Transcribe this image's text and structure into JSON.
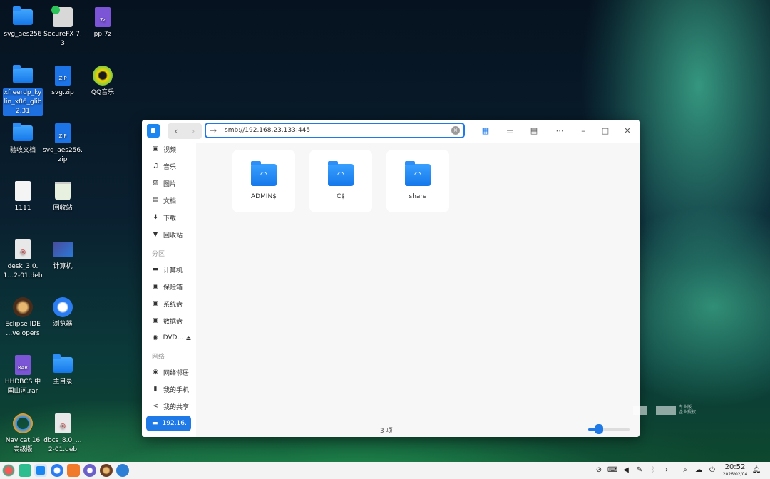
{
  "desktop": {
    "icons": [
      {
        "label": "svg_aes256",
        "icon": "folder-icon"
      },
      {
        "label": "SecureFX 7.3",
        "icon": "securefx-icon"
      },
      {
        "label": "pp.7z",
        "icon": "archive-7z-icon"
      },
      {
        "label": "xfreerdp_kylin_x86_glib2.31",
        "icon": "folder-icon"
      },
      {
        "label": "svg.zip",
        "icon": "zip-icon"
      },
      {
        "label": "QQ音乐",
        "icon": "qqmusic-icon"
      },
      {
        "label": "验收文档",
        "icon": "folder-icon"
      },
      {
        "label": "svg_aes256.zip",
        "icon": "zip-icon"
      },
      {
        "label": "1111",
        "icon": "text-file-icon"
      },
      {
        "label": "回收站",
        "icon": "trash-icon"
      },
      {
        "label": "desk_3.0.1…2-01.deb",
        "icon": "deb-package-icon"
      },
      {
        "label": "计算机",
        "icon": "computer-icon"
      },
      {
        "label": "Eclipse IDE …velopers",
        "icon": "eclipse-icon"
      },
      {
        "label": "浏览器",
        "icon": "browser-icon"
      },
      {
        "label": "HHDBCS 中国山河.rar",
        "icon": "rar-icon"
      },
      {
        "label": "主目录",
        "icon": "home-folder-icon"
      },
      {
        "label": "Navicat 16 高级版",
        "icon": "navicat-icon"
      },
      {
        "label": "dbcs_8.0_…2-01.deb",
        "icon": "deb-package-icon"
      }
    ]
  },
  "window": {
    "address": "smb://192.168.23.133:445",
    "sidebar": {
      "items_top": [
        {
          "label": "视频",
          "icon": "video-icon",
          "glyph": "▣"
        },
        {
          "label": "音乐",
          "icon": "music-icon",
          "glyph": "♫"
        },
        {
          "label": "图片",
          "icon": "picture-icon",
          "glyph": "▨"
        },
        {
          "label": "文档",
          "icon": "document-icon",
          "glyph": "▤"
        },
        {
          "label": "下载",
          "icon": "download-icon",
          "glyph": "⬇"
        },
        {
          "label": "回收站",
          "icon": "trash-icon",
          "glyph": "▼"
        }
      ],
      "group_partition": "分区",
      "items_partition": [
        {
          "label": "计算机",
          "icon": "computer-icon",
          "glyph": "▬"
        },
        {
          "label": "保险箱",
          "icon": "safe-icon",
          "glyph": "▣"
        },
        {
          "label": "系统盘",
          "icon": "disk-icon",
          "glyph": "▣"
        },
        {
          "label": "数据盘",
          "icon": "disk-icon",
          "glyph": "▣"
        },
        {
          "label": "DVD…",
          "icon": "dvd-icon",
          "glyph": "◉"
        }
      ],
      "group_network": "网络",
      "items_network": [
        {
          "label": "网络邻居",
          "icon": "network-icon",
          "glyph": "◉"
        },
        {
          "label": "我的手机",
          "icon": "phone-icon",
          "glyph": "▮"
        },
        {
          "label": "我的共享",
          "icon": "share-icon",
          "glyph": "<"
        },
        {
          "label": "192.16…",
          "icon": "smb-folder-icon",
          "glyph": "▬"
        }
      ]
    },
    "files": [
      {
        "name": "ADMIN$"
      },
      {
        "name": "C$"
      },
      {
        "name": "share"
      }
    ],
    "status": "3 项",
    "zoom_fraction": 0.25
  },
  "watermark": {
    "line1": "专业版",
    "line2": "企业授权"
  },
  "taskbar": {
    "time": "20:52",
    "date": "2026/02/04"
  }
}
